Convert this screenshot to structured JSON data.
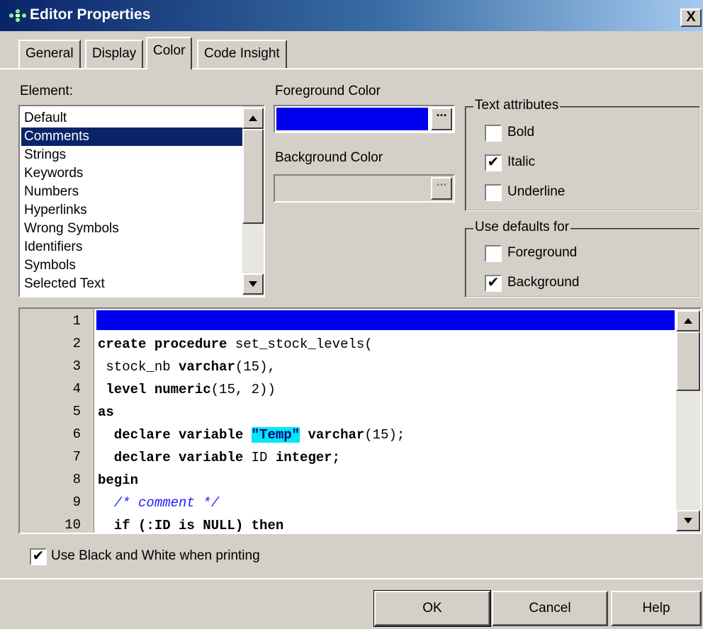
{
  "window": {
    "title": "Editor Properties",
    "close": "X"
  },
  "tabs": [
    {
      "label": "General"
    },
    {
      "label": "Display"
    },
    {
      "label": "Color",
      "active": true
    },
    {
      "label": "Code Insight"
    }
  ],
  "element": {
    "label": "Element:",
    "items": [
      "Default",
      "Comments",
      "Strings",
      "Keywords",
      "Numbers",
      "Hyperlinks",
      "Wrong Symbols",
      "Identifiers",
      "Symbols",
      "Selected Text"
    ],
    "selected": "Comments"
  },
  "foreground": {
    "label": "Foreground Color",
    "value": "#0000f0",
    "button": "···"
  },
  "background": {
    "label": "Background Color",
    "value": "#d4d0c8",
    "button": "···"
  },
  "text_attributes": {
    "title": "Text attributes",
    "bold": {
      "label": "Bold",
      "checked": false
    },
    "italic": {
      "label": "Italic",
      "checked": true
    },
    "underline": {
      "label": "Underline",
      "checked": false
    }
  },
  "use_defaults": {
    "title": "Use defaults for",
    "foreground": {
      "label": "Foreground",
      "checked": false
    },
    "background": {
      "label": "Background",
      "checked": true
    }
  },
  "editor": {
    "line_numbers": [
      "1",
      "2",
      "3",
      "4",
      "5",
      "6",
      "7",
      "8",
      "9",
      "10"
    ],
    "line2_kw": "create procedure",
    "line2_rest": " set_stock_levels(",
    "line3_a": " stock_nb ",
    "line3_kw": "varchar",
    "line3_b": "(15),",
    "line4_kw1": " level numeric",
    "line4_b": "(15, 2))",
    "line5_kw": "as",
    "line6_kw": "  declare variable ",
    "line6_str": "\"Temp\"",
    "line6_kw2": " varchar",
    "line6_b": "(15);",
    "line7_kw": "  declare variable ",
    "line7_id": "ID",
    "line7_kw2": " integer;",
    "line8_kw": "begin",
    "line9_cm": "  /* comment */",
    "line10_kw": "  if (:ID is NULL) then"
  },
  "print_bw": {
    "label": "Use Black and White when printing",
    "checked": true
  },
  "buttons": {
    "ok": "OK",
    "cancel": "Cancel",
    "help": "Help"
  },
  "colors": {
    "title_bar": "#0a246a",
    "selection": "#0a246a",
    "highlight_line": "#0000f0",
    "string_bg": "#00e8f0",
    "comment": "#2020ff"
  }
}
